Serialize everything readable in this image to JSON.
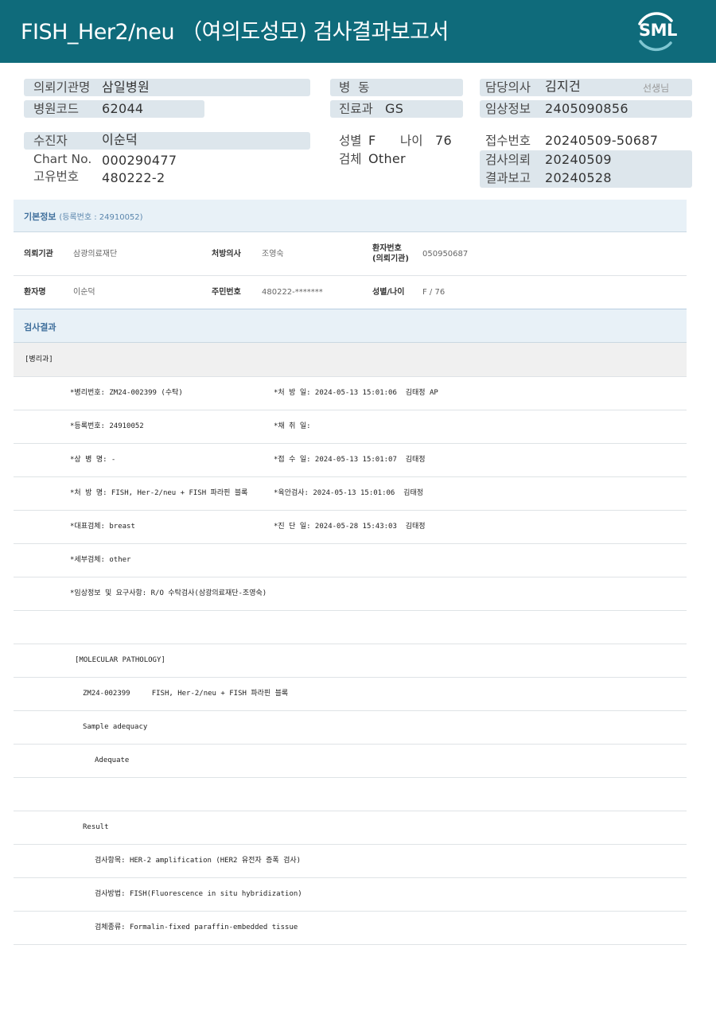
{
  "header": {
    "title": "FISH_Her2/neu （여의도성모) 검사결과보고서",
    "logo": "SML"
  },
  "info": {
    "institution_label": "의뢰기관명",
    "institution_value": "삼일병원",
    "hospital_code_label": "병원코드",
    "hospital_code_value": "62044",
    "ward_label": "병  동",
    "dept_label": "진료과",
    "dept_value": "GS",
    "doctor_label": "담당의사",
    "doctor_value": "김지건",
    "doctor_suffix": "선생님",
    "clinical_label": "임상정보",
    "clinical_value": "2405090856",
    "patient_label": "수진자",
    "patient_value": "이순덕",
    "chart_label": "Chart No.",
    "chart_value": "000290477",
    "unique_label": "고유번호",
    "unique_value": "480222-2",
    "sex_label": "성별",
    "sex_value": "F",
    "age_label": "나이",
    "age_value": "76",
    "specimen_label": "검체",
    "specimen_value": "Other",
    "receipt_label": "접수번호",
    "receipt_value": "20240509-50687",
    "request_label": "검사의뢰",
    "request_value": "20240509",
    "report_label": "결과보고",
    "report_value": "20240528"
  },
  "basic": {
    "title": "기본정보",
    "subtitle": "(등록번호 : 24910052)",
    "inst_label": "의뢰기관",
    "inst_value": "삼광의료재단",
    "presc_label": "처방의사",
    "presc_value": "조영숙",
    "pid_label_1": "환자번호",
    "pid_label_2": "(의뢰기관)",
    "pid_value": "050950687",
    "name_label": "환자명",
    "name_value": "이순덕",
    "rrn_label": "주민번호",
    "rrn_value": "480222-*******",
    "sexage_label": "성별/나이",
    "sexage_value": "F / 76"
  },
  "result": {
    "title": "검사결과",
    "subheader": "[병리과]",
    "lines": [
      {
        "left": "*병리번호: ZM24-002399 (수탁)",
        "right": "*처 방 일: 2024-05-13 15:01:06  김태정 AP"
      },
      {
        "left": "*등록번호: 24910052",
        "right": "*채 취 일:"
      },
      {
        "left": "*상 병 명: -",
        "right": "*접 수 일: 2024-05-13 15:01:07  김태정"
      },
      {
        "left": "*처 방 명: FISH, Her-2/neu + FISH 파라핀 블록",
        "right": "*육안검사: 2024-05-13 15:01:06  김태정"
      },
      {
        "left": "*대표검체: breast",
        "right": "*진 단 일: 2024-05-28 15:43:03  김태정"
      },
      {
        "left": "*세부검체: other",
        "right": ""
      },
      {
        "left": "*임상정보 및 요구사항: R/O 수탁검사(삼광의료재단-조영숙)",
        "right": ""
      }
    ],
    "mol_header": "[MOLECULAR PATHOLOGY]",
    "mol_code": "ZM24-002399     FISH, Her-2/neu + FISH 파라핀 블록",
    "sample_adequacy": "Sample adequacy",
    "adequate": "Adequate",
    "result_label": "Result",
    "item": "검사항목: HER-2 amplification (HER2 유전자 증폭 검사)",
    "method": "검사방법: FISH(Fluorescence in situ hybridization)",
    "specimen_type": "검체종류: Formalin-fixed paraffin-embedded tissue"
  }
}
